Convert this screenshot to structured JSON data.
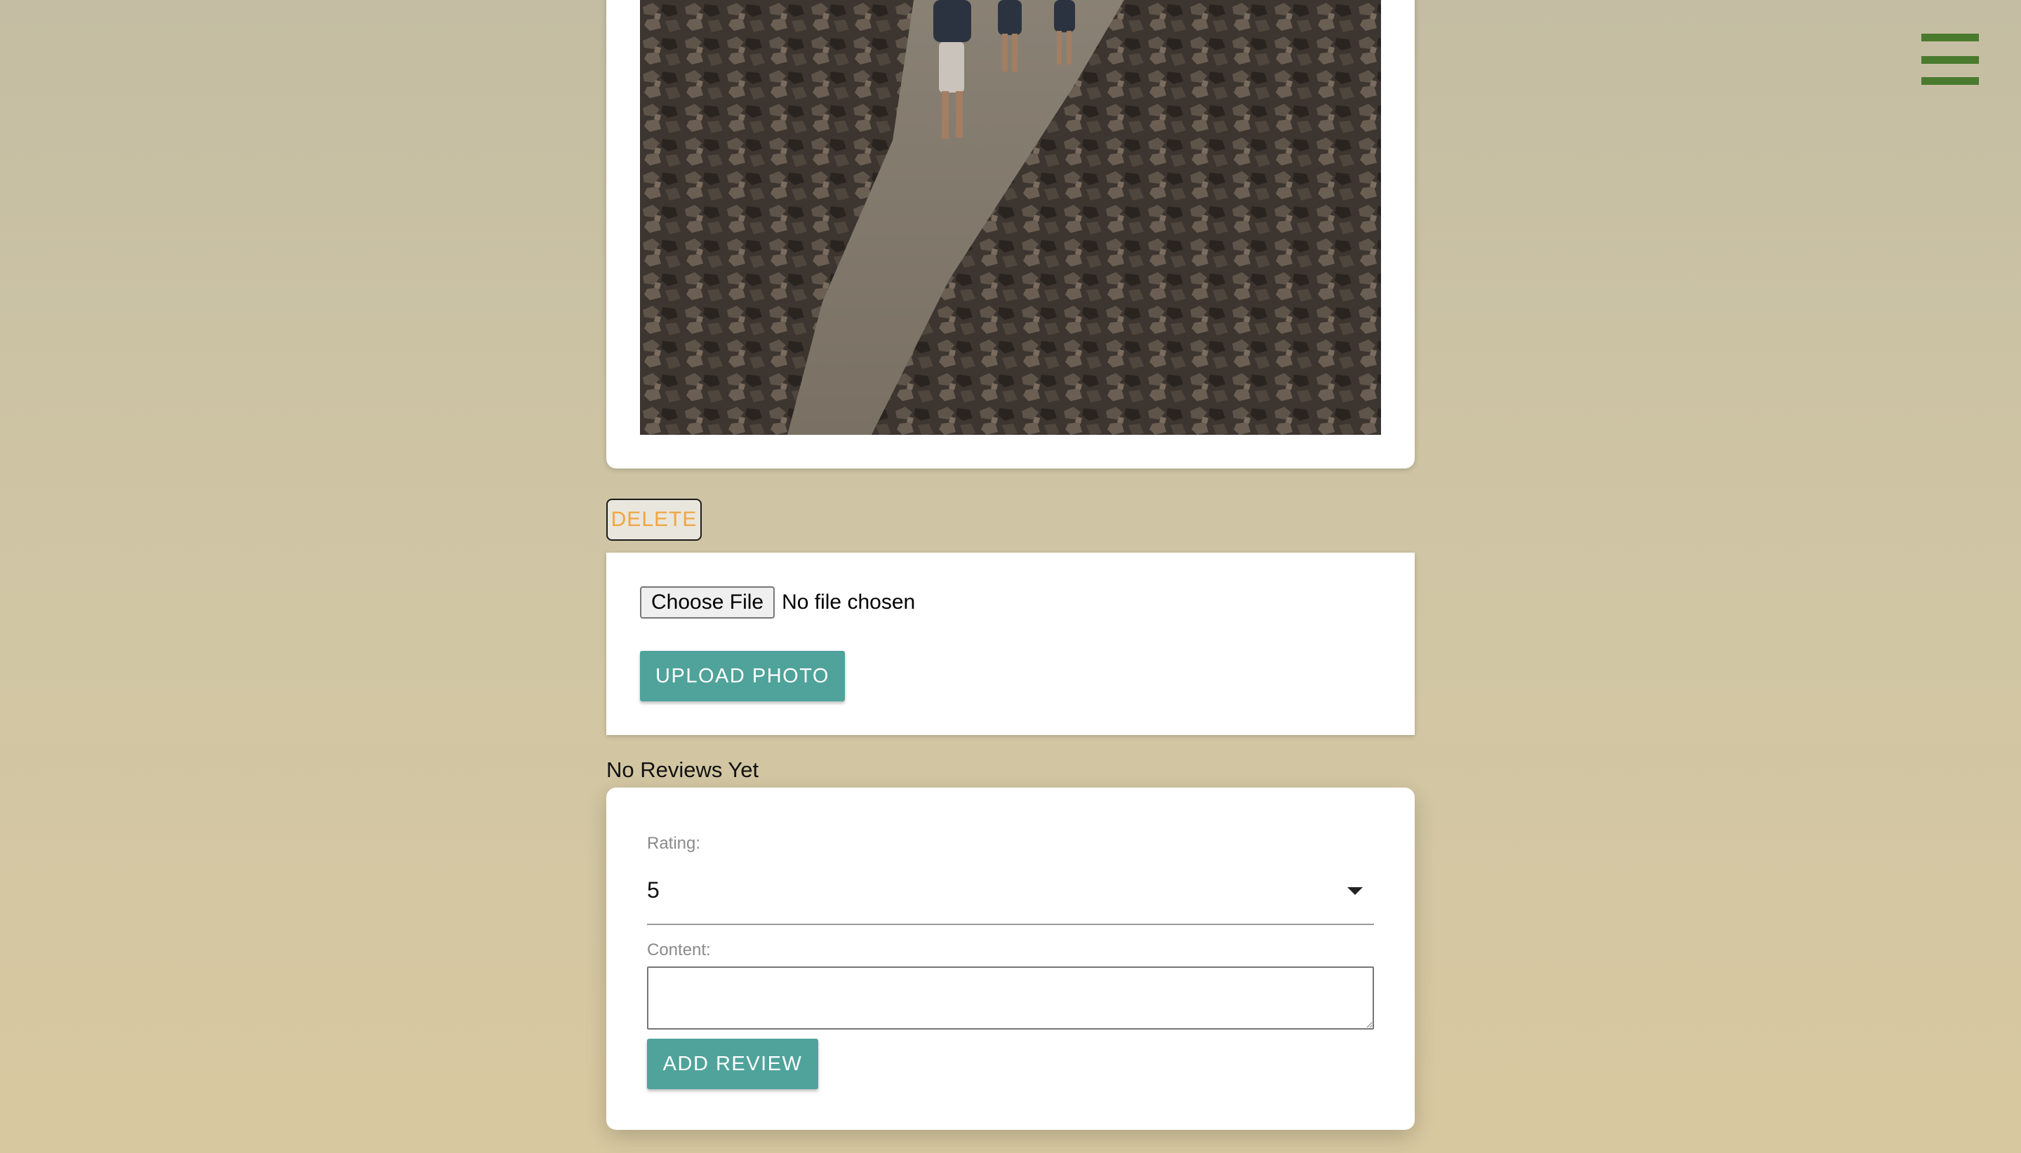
{
  "nav": {
    "menu_icon": "hamburger-menu-icon",
    "accent_color": "#4a7a2e"
  },
  "photo": {
    "description_icon": "trail-photo"
  },
  "actions": {
    "delete_label": "DELETE"
  },
  "upload": {
    "choose_file_label": "Choose File",
    "file_status": "No file chosen",
    "upload_label": "UPLOAD PHOTO"
  },
  "reviews": {
    "empty_text": "No Reviews Yet"
  },
  "review_form": {
    "rating_label": "Rating:",
    "rating_value": "5",
    "content_label": "Content:",
    "content_value": "",
    "submit_label": "ADD REVIEW"
  },
  "colors": {
    "button_teal": "#4fa39a",
    "delete_text": "#f0a640"
  }
}
